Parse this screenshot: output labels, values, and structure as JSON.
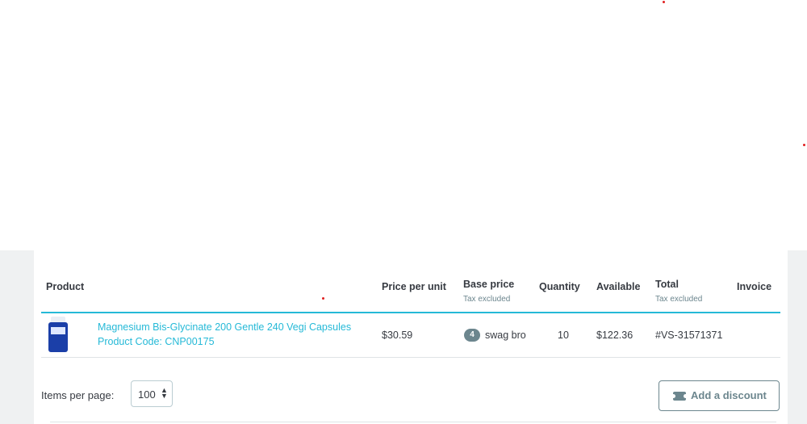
{
  "table": {
    "headers": {
      "product": "Product",
      "price_per_unit": "Price per unit",
      "base_price": "Base price",
      "base_price_sub": "Tax excluded",
      "quantity": "Quantity",
      "available": "Available",
      "total": "Total",
      "total_sub": "Tax excluded",
      "invoice": "Invoice"
    },
    "rows": [
      {
        "name": "Magnesium Bis-Glycinate 200 Gentle 240 Vegi Capsules",
        "code": "Product Code: CNP00175",
        "price_per_unit": "$30.59",
        "base_price_badge": "4",
        "base_price": "swag bro",
        "quantity": "10",
        "available": "$122.36",
        "total": "#VS-31571371",
        "invoice": ""
      }
    ]
  },
  "pagination": {
    "items_per_page_label": "Items per page:",
    "items_per_page_value": "100"
  },
  "actions": {
    "add_discount": "Add a discount"
  },
  "colors": {
    "accent": "#25b9d7",
    "text": "#363a41",
    "muted": "#6c868e",
    "gutter": "#eff1f2"
  }
}
